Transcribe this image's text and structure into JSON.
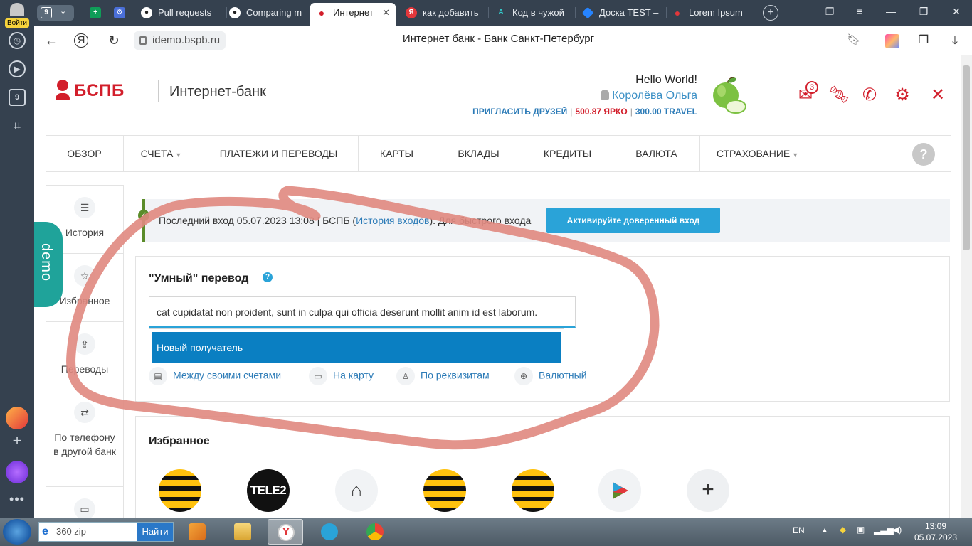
{
  "sidebar": {
    "login_label": "Войти",
    "tab_count": "9"
  },
  "tabs": [
    {
      "label": "Pull requests",
      "icon": "github-icon"
    },
    {
      "label": "Comparing m",
      "icon": "github-icon"
    },
    {
      "label": "Интернет",
      "icon": "bspb-icon"
    },
    {
      "label": "как добавить",
      "icon": "yandex-icon"
    },
    {
      "label": "Код в чужой",
      "icon": "code-icon"
    },
    {
      "label": "Доска TEST –",
      "icon": "jira-icon"
    },
    {
      "label": "Lorem Ipsum",
      "icon": "lorem-icon"
    }
  ],
  "tabs_count_badge": "9",
  "address": {
    "url": "idemo.bspb.ru",
    "page_title": "Интернет банк - Банк Санкт-Петербург"
  },
  "header": {
    "brand": "БСПБ",
    "subtitle": "Интернет-банк",
    "greeting": "Hello World!",
    "user_name": "Королёва Ольга",
    "invite": "ПРИГЛАСИТЬ ДРУЗЕЙ",
    "bonus_yarko": "500.87 ЯРКО",
    "bonus_travel": "300.00 TRAVEL",
    "mail_count": "3"
  },
  "nav": {
    "items": [
      {
        "label": "Обзор",
        "caret": false
      },
      {
        "label": "Счета",
        "caret": true
      },
      {
        "label": "Платежи и переводы",
        "caret": false
      },
      {
        "label": "Карты",
        "caret": false
      },
      {
        "label": "Вклады",
        "caret": false
      },
      {
        "label": "Кредиты",
        "caret": false
      },
      {
        "label": "Валюта",
        "caret": false
      },
      {
        "label": "Страхование",
        "caret": true
      }
    ],
    "help": "?"
  },
  "rail": {
    "items": [
      {
        "label": "История",
        "icon": "list-icon"
      },
      {
        "label": "Избранное",
        "icon": "star-icon"
      },
      {
        "label": "Переводы",
        "icon": "transfer-icon"
      },
      {
        "label": "По телефону в другой банк",
        "icon": "phone-transfer-icon"
      }
    ]
  },
  "demo_tag": "demo",
  "last_login": {
    "prefix": "Последний вход 05.07.2023 13:08 | БСПБ (",
    "link": "История входов",
    "suffix": "). Для быстрого входа",
    "button": "Активируйте доверенный вход"
  },
  "smart_transfer": {
    "title": "\"Умный\" перевод",
    "input_value": "cat cupidatat non proident, sunt in culpa qui officia deserunt mollit anim id est laborum.",
    "suggestion": "Новый получатель",
    "quick_links": [
      {
        "label": "Между своими счетами",
        "icon": "accounts-icon"
      },
      {
        "label": "На карту",
        "icon": "card-icon"
      },
      {
        "label": "По реквизитам",
        "icon": "requisites-icon"
      },
      {
        "label": "Валютный",
        "icon": "globe-icon"
      }
    ]
  },
  "favorites": {
    "title": "Избранное",
    "items": [
      {
        "icon": "beeline-icon"
      },
      {
        "label": "TELE2",
        "icon": "tele2-icon"
      },
      {
        "icon": "house-icon"
      },
      {
        "icon": "beeline-icon"
      },
      {
        "icon": "beeline-icon"
      },
      {
        "icon": "play-icon"
      },
      {
        "label": "+",
        "icon": "add-icon"
      }
    ]
  },
  "taskbar": {
    "search_value": "360 zip",
    "search_button": "Найти",
    "lang": "EN",
    "time": "13:09",
    "date": "05.07.2023"
  },
  "colors": {
    "brand_red": "#d21e2b",
    "link_blue": "#2c7bb7",
    "accent_blue": "#2aa3d8",
    "selected_blue": "#0a7fc2",
    "demo_teal": "#1fa39a",
    "annotation": "#e08880"
  }
}
